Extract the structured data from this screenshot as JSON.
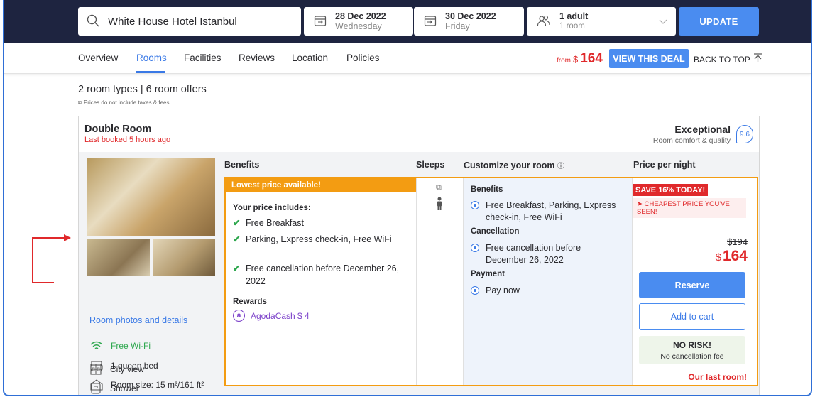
{
  "search": {
    "query": "White House Hotel Istanbul",
    "checkin_date": "28 Dec 2022",
    "checkin_day": "Wednesday",
    "checkout_date": "30 Dec 2022",
    "checkout_day": "Friday",
    "guests": "1 adult",
    "rooms": "1 room",
    "update_label": "UPDATE"
  },
  "tabs": [
    "Overview",
    "Rooms",
    "Facilities",
    "Reviews",
    "Location",
    "Policies"
  ],
  "active_tab": "Rooms",
  "deal": {
    "from_label": "from",
    "currency": "$",
    "price": "164",
    "view_label": "VIEW THIS DEAL",
    "back_to_top": "BACK TO TOP"
  },
  "summary": {
    "text": "2 room types | 6 room offers",
    "tax_note": "Prices do not include taxes & fees"
  },
  "room": {
    "name": "Double Room",
    "last_booked": "Last booked 5 hours ago",
    "rating_word": "Exceptional",
    "rating_sub": "Room comfort & quality",
    "rating_score": "9.6",
    "photo_link": "Room photos and details",
    "features": [
      {
        "icon": "wifi-icon",
        "label": "Free Wi-Fi"
      },
      {
        "icon": "bed-icon",
        "label": "1 queen bed"
      },
      {
        "icon": "room-size-icon",
        "label": "Room size: 15 m²/161 ft²"
      },
      {
        "icon": "city-view-icon",
        "label": "City view"
      },
      {
        "icon": "shower-icon",
        "label": "Shower"
      }
    ]
  },
  "columns": {
    "benefits": "Benefits",
    "sleeps": "Sleeps",
    "customize": "Customize your room",
    "price": "Price per night"
  },
  "offer": {
    "lowest_label": "Lowest price available!",
    "includes_title": "Your price includes:",
    "includes": [
      "Free Breakfast",
      "Parking, Express check-in, Free WiFi",
      "Free cancellation before December 26, 2022"
    ],
    "rewards_title": "Rewards",
    "rewards_value": "AgodaCash $ 4",
    "customize": {
      "benefits_title": "Benefits",
      "benefits_option": "Free Breakfast, Parking, Express check-in, Free WiFi",
      "cancellation_title": "Cancellation",
      "cancellation_option": "Free cancellation before December 26, 2022",
      "payment_title": "Payment",
      "payment_option": "Pay now"
    },
    "price": {
      "save_badge": "SAVE 16% TODAY!",
      "cheapest": "CHEAPEST PRICE YOU'VE SEEN!",
      "old_price": "$194",
      "currency": "$",
      "new_price": "164",
      "reserve_label": "Reserve",
      "cart_label": "Add to cart",
      "norisk_title": "NO RISK!",
      "norisk_sub": "No cancellation fee",
      "last_room": "Our last room!"
    }
  },
  "colors": {
    "accent": "#4a8cf0",
    "header_bg": "#1e2440",
    "sale_red": "#e0292b",
    "offer_orange": "#f39c12",
    "check_green": "#2fa84f"
  }
}
